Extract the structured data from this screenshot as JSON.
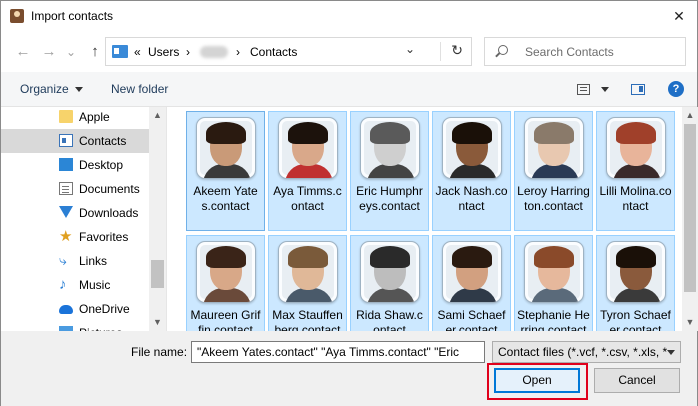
{
  "window": {
    "title": "Import contacts",
    "close_glyph": "✕"
  },
  "nav": {
    "back_glyph": "←",
    "forward_glyph": "→",
    "recent_glyph": "⌄",
    "up_glyph": "↑",
    "address": {
      "prefix": "«",
      "users": "Users",
      "sep": "›",
      "folder": "Contacts",
      "chevron": "⌄",
      "refresh": "↻"
    },
    "search_placeholder": "Search Contacts"
  },
  "toolbar": {
    "organize": "Organize",
    "new_folder": "New folder",
    "help": "?"
  },
  "sidebar": {
    "items": [
      {
        "label": "Apple",
        "icon": "folder-icon"
      },
      {
        "label": "Contacts",
        "icon": "contacts-icon",
        "selected": true
      },
      {
        "label": "Desktop",
        "icon": "desktop-icon"
      },
      {
        "label": "Documents",
        "icon": "documents-icon"
      },
      {
        "label": "Downloads",
        "icon": "downloads-icon"
      },
      {
        "label": "Favorites",
        "icon": "favorites-icon"
      },
      {
        "label": "Links",
        "icon": "links-icon"
      },
      {
        "label": "Music",
        "icon": "music-icon"
      },
      {
        "label": "OneDrive",
        "icon": "onedrive-icon"
      },
      {
        "label": "Pictures",
        "icon": "pictures-icon"
      }
    ],
    "scroll_up": "▲",
    "scroll_down": "▼"
  },
  "files": {
    "items": [
      {
        "label": "Akeem Yates.contact",
        "skin": "#c99a78",
        "hair": "#2a1a10",
        "shirt": "#3a3a3a"
      },
      {
        "label": "Aya Timms.contact",
        "skin": "#d9a88a",
        "hair": "#1c120c",
        "shirt": "#c03030"
      },
      {
        "label": "Eric Humphreys.contact",
        "skin": "#cfcfcf",
        "hair": "#5a5a5a",
        "shirt": "#444444"
      },
      {
        "label": "Jack Nash.contact",
        "skin": "#8a5a3a",
        "hair": "#1a1008",
        "shirt": "#2a2a2a"
      },
      {
        "label": "Leroy Harrington.contact",
        "skin": "#e8c8b0",
        "hair": "#8a7a6a",
        "shirt": "#2a3a55"
      },
      {
        "label": "Lilli Molina.contact",
        "skin": "#e8b49a",
        "hair": "#a0402a",
        "shirt": "#3a2a2a"
      },
      {
        "label": "Maureen Griffin.contact",
        "skin": "#d8a888",
        "hair": "#3a2418",
        "shirt": "#6a4a3a"
      },
      {
        "label": "Max Stauffenberg.contact",
        "skin": "#e0b898",
        "hair": "#7a5a3a",
        "shirt": "#4a5a6a"
      },
      {
        "label": "Rida Shaw.contact",
        "skin": "#bdbdbd",
        "hair": "#2a2a2a",
        "shirt": "#555555"
      },
      {
        "label": "Sami Schaefer.contact",
        "skin": "#d2a080",
        "hair": "#2a1a10",
        "shirt": "#2f3a48"
      },
      {
        "label": "Stephanie Herring.contact",
        "skin": "#e6b89c",
        "hair": "#8a4a2a",
        "shirt": "#5a6a7a"
      },
      {
        "label": "Tyron Schaefer.contact",
        "skin": "#8a5a3c",
        "hair": "#1a1008",
        "shirt": "#3a3a3a"
      }
    ],
    "scroll_up": "▲",
    "scroll_down": "▼"
  },
  "bottom": {
    "file_name_label": "File name:",
    "file_name_value": "\"Akeem Yates.contact\" \"Aya Timms.contact\" \"Eric",
    "filter_value": "Contact files (*.vcf, *.csv, *.xls, *",
    "open_label": "Open",
    "cancel_label": "Cancel"
  },
  "colors": {
    "accent": "#0078d7",
    "selection": "#cce8ff",
    "highlight": "#e0001b"
  }
}
